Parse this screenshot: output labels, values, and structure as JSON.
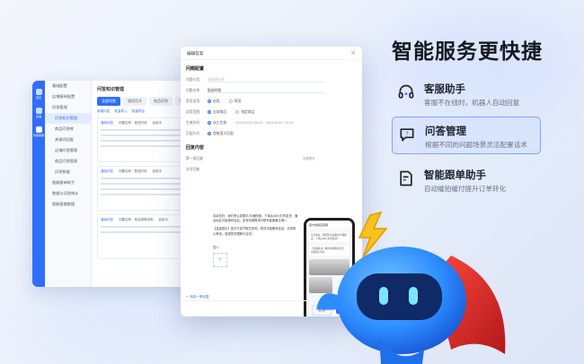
{
  "headline": "智能服务更快捷",
  "features": [
    {
      "title": "客服助手",
      "desc": "客服不在线时，机器人自动回复",
      "icon": "headset-icon",
      "highlighted": false
    },
    {
      "title": "问答管理",
      "desc": "根据不同的问题场景灵活配置话术",
      "icon": "chat-bubble-icon",
      "highlighted": true
    },
    {
      "title": "智能跟单助手",
      "desc": "自动催拍催付提升订单转化",
      "icon": "document-edit-icon",
      "highlighted": false
    }
  ],
  "admin": {
    "title": "问答知识管理",
    "rail": [
      "首页",
      "店铺",
      "智能客服"
    ],
    "nav": [
      {
        "label": "基础配置",
        "active": false,
        "sub": false
      },
      {
        "label": "店铺接待配置",
        "active": false,
        "sub": false
      },
      {
        "label": "问答管理",
        "active": false,
        "sub": false
      },
      {
        "label": "问答知识管理",
        "active": true,
        "sub": true
      },
      {
        "label": "商品问答库",
        "active": false,
        "sub": true
      },
      {
        "label": "关键词回复",
        "active": false,
        "sub": true
      },
      {
        "label": "店铺问答管理",
        "active": false,
        "sub": true
      },
      {
        "label": "商品问答管理",
        "active": false,
        "sub": true
      },
      {
        "label": "问答数据",
        "active": false,
        "sub": true
      },
      {
        "label": "智能跟单助手",
        "active": false,
        "sub": false
      },
      {
        "label": "数据与问答统计",
        "active": false,
        "sub": false
      },
      {
        "label": "智能客服数据",
        "active": false,
        "sub": false
      }
    ],
    "tabs": [
      "全部问答",
      "通用话术",
      "商品问答",
      "物流问答"
    ],
    "actions": [
      "新增问答",
      "批量导入",
      "批量导出"
    ],
    "cards": [
      {
        "tag": "通用问答",
        "q": "问题名称：配送时效",
        "status": "启用中"
      },
      {
        "tag": "通用问答",
        "q": "问题名称：配送时效",
        "status": "启用中"
      },
      {
        "tag": "通用问答",
        "q": "问题名称：商品退换说明",
        "status": "启用中"
      }
    ]
  },
  "modal": {
    "title": "编辑答案",
    "close": "×",
    "section1": "问题配置",
    "fields": [
      {
        "label": "问题分类",
        "value": "请选择分类"
      },
      {
        "label": "问题名称",
        "value": "配送时效"
      }
    ],
    "field_enable": {
      "label": "是否启用",
      "opt1": "启用",
      "opt2": "停用"
    },
    "field_scope": {
      "label": "适用范围",
      "opt1": "全部商品",
      "opt2": "指定商品"
    },
    "field_time": {
      "label": "生效时间",
      "value": "永久生效",
      "hint": "2023/01/01 00:00 - 2024/01/01 00:00"
    },
    "field_hint": {
      "label": "匹配方式",
      "value": "智能语义匹配"
    },
    "section2": "回复内容",
    "reply_label": "第一条回复",
    "reply_type": "文字回复",
    "reply_text": "亲亲您好，我们默认发顺丰/中通快递，下单后48小时内发货，偏远地区可能稍有延迟。如有特殊需求可联系客服备注哦～",
    "reply_text2": "【温馨提示】因天气或节假日影响，物流可能略有延迟，请您耐心等待，感谢您的理解与支持！",
    "add_reply": "+ 添加一条回复",
    "image_label": "图片",
    "preview_title": "效果预览",
    "phone_title": "官方旗舰店客服",
    "phone_msg1": "亲亲您好，我们默认发顺丰/中通快递，下单后48小时内发货～",
    "phone_msg2": "【温馨提示】物流可能略有延迟，请您耐心等待",
    "cancel": "取消",
    "save": "保存"
  },
  "colors": {
    "accent": "#2f6ef7",
    "headline": "#141821",
    "mascot": "#2d8cff",
    "cape": "#d9322b",
    "bolt": "#f7c21b"
  }
}
